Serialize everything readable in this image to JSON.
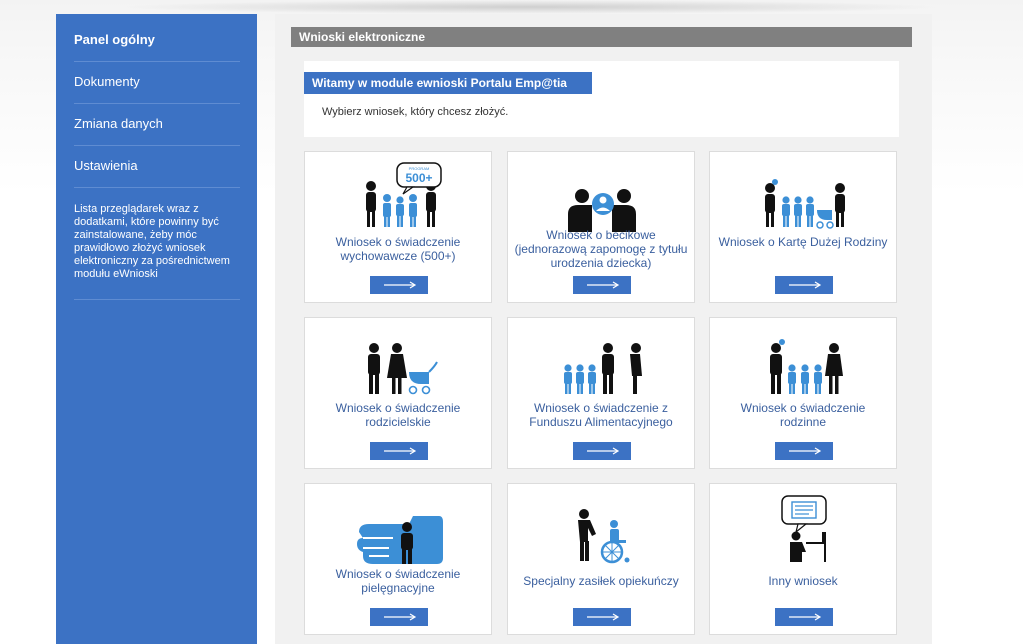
{
  "sidebar": {
    "items": [
      {
        "label": "Panel ogólny"
      },
      {
        "label": "Dokumenty"
      },
      {
        "label": "Zmiana danych"
      },
      {
        "label": "Ustawienia"
      }
    ],
    "note": "Lista przeglądarek wraz z dodatkami, które powinny być zainstalowane, żeby móc prawidłowo złożyć wniosek elektroniczny za pośrednictwem modułu eWnioski"
  },
  "header": {
    "title": "Wnioski elektroniczne"
  },
  "welcome": {
    "title": "Witamy w module ewnioski Portalu Emp@tia",
    "text": "Wybierz wniosek, który chcesz złożyć."
  },
  "cards": [
    {
      "label": "Wniosek o świadczenie wychowawcze (500+)",
      "icon": "family-500plus-icon",
      "badge": "500+",
      "badge_top": "PROGRAM"
    },
    {
      "label": "Wniosek o becikowe (jednorazową zapomogę z tytułu urodzenia dziecka)",
      "icon": "parents-baby-icon"
    },
    {
      "label": "Wniosek o Kartę Dużej Rodziny",
      "icon": "large-family-icon"
    },
    {
      "label": "Wniosek o świadczenie rodzicielskie",
      "icon": "parents-stroller-icon"
    },
    {
      "label": "Wniosek o świadczenie z Funduszu Alimentacyjnego",
      "icon": "alimony-family-icon"
    },
    {
      "label": "Wniosek o świadczenie rodzinne",
      "icon": "family-icon"
    },
    {
      "label": "Wniosek o świadczenie pielęgnacyjne",
      "icon": "care-hand-icon"
    },
    {
      "label": "Specjalny zasiłek opiekuńczy",
      "icon": "wheelchair-caregiver-icon"
    },
    {
      "label": "Inny wniosek",
      "icon": "person-computer-icon"
    }
  ],
  "colors": {
    "accent": "#3c72c4",
    "header": "#808080",
    "link": "#3a5f9e"
  }
}
